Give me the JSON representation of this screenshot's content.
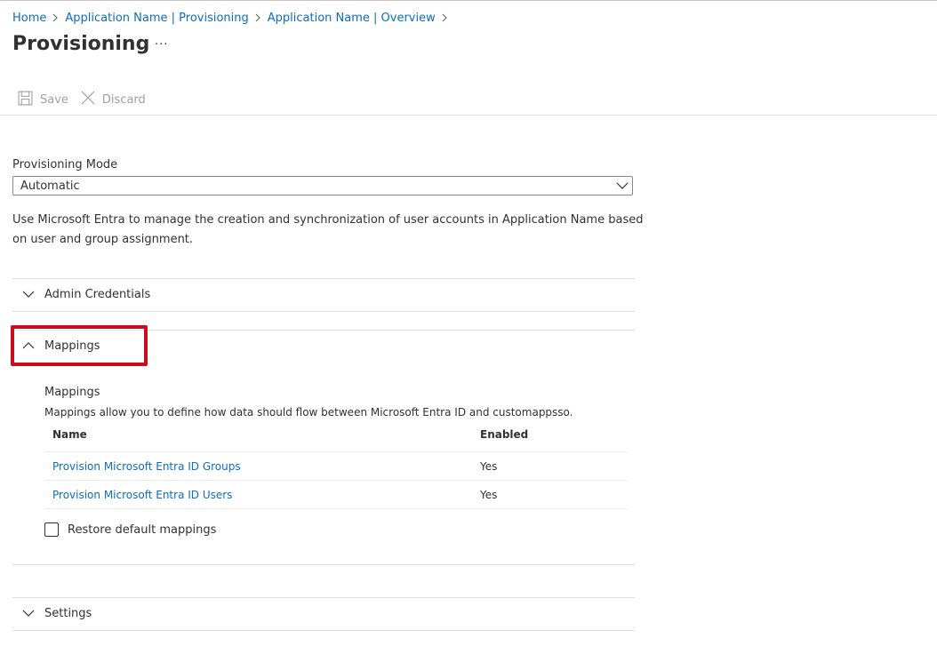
{
  "breadcrumb": {
    "items": [
      "Home",
      "Application Name | Provisioning",
      "Application Name | Overview"
    ]
  },
  "page": {
    "title": "Provisioning",
    "more_label": "···"
  },
  "toolbar": {
    "save_label": "Save",
    "discard_label": "Discard"
  },
  "provisioning_mode": {
    "label": "Provisioning Mode",
    "selected": "Automatic",
    "description": "Use Microsoft Entra to manage the creation and synchronization of user accounts in Application Name based on user and group assignment."
  },
  "sections": {
    "admin_credentials": {
      "label": "Admin Credentials",
      "expanded": false
    },
    "mappings": {
      "label": "Mappings",
      "expanded": true
    },
    "settings": {
      "label": "Settings",
      "expanded": false
    }
  },
  "mappings": {
    "title": "Mappings",
    "description": "Mappings allow you to define how data should flow between Microsoft Entra ID and customappsso.",
    "columns": [
      "Name",
      "Enabled"
    ],
    "rows": [
      {
        "name": "Provision Microsoft Entra ID Groups",
        "enabled": "Yes"
      },
      {
        "name": "Provision Microsoft Entra ID Users",
        "enabled": "Yes"
      }
    ],
    "restore_label": "Restore default mappings",
    "restore_checked": false
  },
  "colors": {
    "link": "#0f6cbd",
    "highlight": "#c50f1f",
    "text": "#323130",
    "disabled": "#a19f9d"
  }
}
